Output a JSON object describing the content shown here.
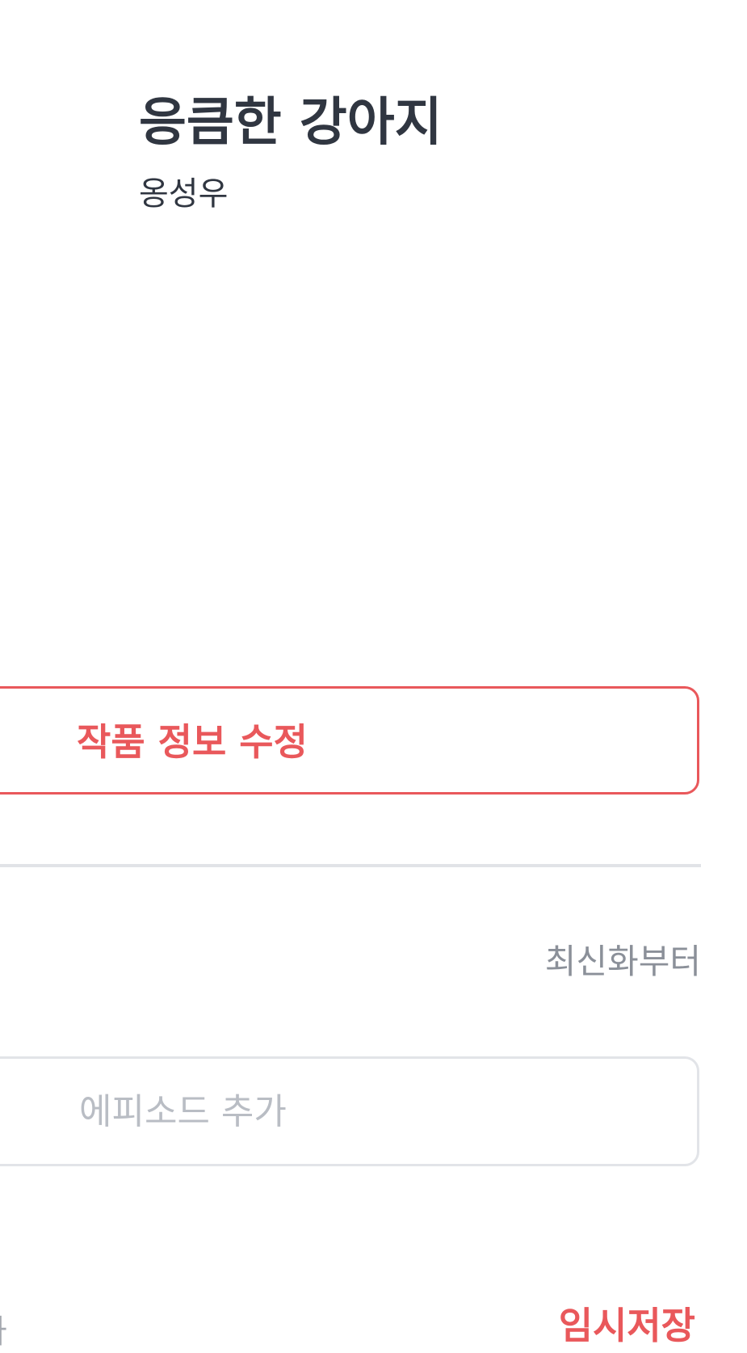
{
  "work": {
    "title": "응큼한 강아지",
    "author": "옹성우"
  },
  "actions": {
    "edit_work_info_label": "작품 정보 수정"
  },
  "episodes": {
    "sort_label": "최신화부터",
    "add_episode_placeholder": "에피소드 추가",
    "cut_off_left_text": "가",
    "cut_off_right_link": "임시저장"
  },
  "colors": {
    "accent": "#e9585b",
    "text_primary": "#303641",
    "text_secondary": "#8b9099",
    "border_muted": "#e2e4e8"
  }
}
